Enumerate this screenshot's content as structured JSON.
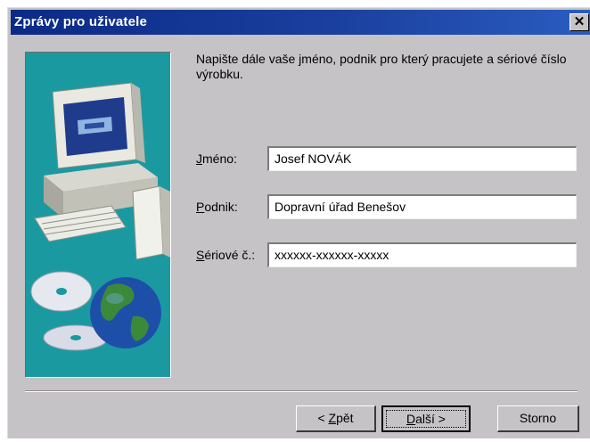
{
  "window": {
    "title": "Zprávy pro uživatele",
    "close_glyph": "✕"
  },
  "instruction": "Napište dále vaše jméno, podnik pro který pracujete a sériové číslo výrobku.",
  "fields": [
    {
      "label_accel": "J",
      "label_rest": "méno:",
      "value": "Josef NOVÁK"
    },
    {
      "label_accel": "P",
      "label_rest": "odnik:",
      "value": "Dopravní úřad Benešov"
    },
    {
      "label_accel": "S",
      "label_rest": "ériové č.:",
      "value": "xxxxxx-xxxxxx-xxxxx"
    }
  ],
  "buttons": {
    "back_pre": "< ",
    "back_accel": "Z",
    "back_rest": "pět",
    "next_accel": "D",
    "next_rest": "alší >",
    "cancel": "Storno"
  },
  "illustration": {
    "subject": [
      "computer-icon",
      "cd-disc-icon",
      "globe-icon"
    ],
    "colors": {
      "background": "#1a9aa0",
      "monitor": "#e9e9e2",
      "screen": "#1f3b8c",
      "globe_ocean": "#1e4fa8",
      "globe_land": "#3b8a3a"
    }
  }
}
